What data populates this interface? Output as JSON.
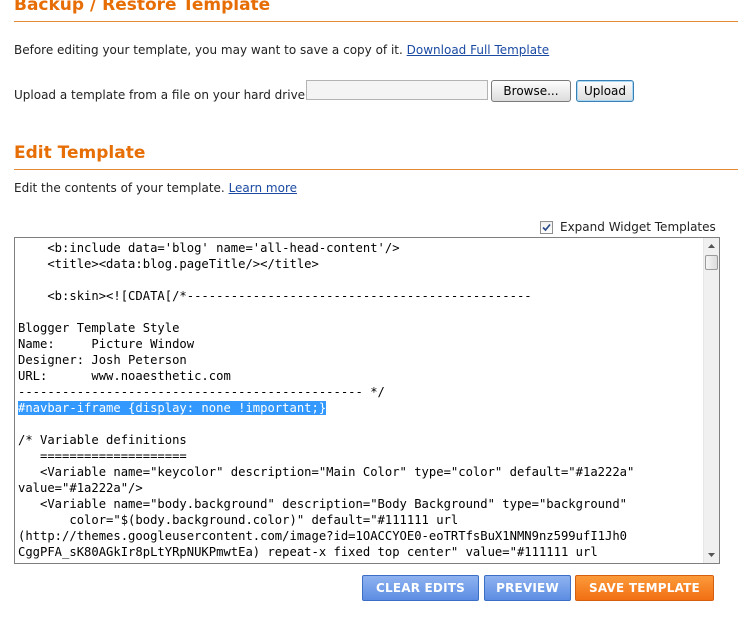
{
  "backup": {
    "title": "Backup / Restore Template",
    "intro_text": "Before editing your template, you may want to save a copy of it.",
    "download_link": "Download Full Template",
    "upload_label": "Upload a template from a file on your hard drive:",
    "file_value": "",
    "browse_label": "Browse...",
    "upload_button": "Upload"
  },
  "edit": {
    "title": "Edit Template",
    "intro_text": "Edit the contents of your template.",
    "learn_more": "Learn more",
    "expand_widgets_label": "Expand Widget Templates",
    "expand_widgets_checked": true
  },
  "editor": {
    "selected_line": 10,
    "lines": [
      "    <b:include data='blog' name='all-head-content'/>",
      "    <title><data:blog.pageTitle/></title>",
      "",
      "    <b:skin><![CDATA[/*-----------------------------------------------",
      "",
      "Blogger Template Style",
      "Name:     Picture Window",
      "Designer: Josh Peterson",
      "URL:      www.noaesthetic.com",
      "----------------------------------------------- */",
      "#navbar-iframe {display: none !important;}",
      "",
      "/* Variable definitions",
      "   ====================",
      "   <Variable name=\"keycolor\" description=\"Main Color\" type=\"color\" default=\"#1a222a\"",
      "value=\"#1a222a\"/>",
      "   <Variable name=\"body.background\" description=\"Body Background\" type=\"background\"",
      "       color=\"$(body.background.color)\" default=\"#111111 url",
      "(http://themes.googleusercontent.com/image?id=1OACCYOE0-eoTRTfsBuX1NMN9nz599ufI1Jh0",
      "CggPFA_sK80AGkIr8pLtYRpNUKPmwtEa) repeat-x fixed top center\" value=\"#111111 url"
    ]
  },
  "actions": {
    "clear_edits": "CLEAR EDITS",
    "preview": "PREVIEW",
    "save_template": "SAVE TEMPLATE"
  },
  "colors": {
    "heading": "#e76d05",
    "link": "#1b4aa3",
    "selection": "#3399ff",
    "blue_button": "#5c8ce2",
    "orange_button": "#f26f14"
  }
}
